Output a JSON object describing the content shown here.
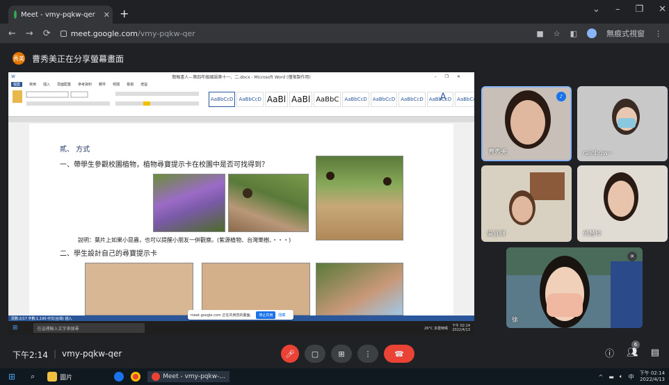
{
  "browser": {
    "tab_title": "Meet - vmy-pqkw-qer",
    "url_host": "meet.google.com",
    "url_path": "/vmy-pqkw-qer",
    "profile_label": "無痕式視窗"
  },
  "banner": {
    "avatar_text": "秀美",
    "text": "曹秀美正在分享螢幕畫面"
  },
  "word": {
    "title": "簡報書人—第四年級國語第十一、二.docx - Microsoft Word (僅限製作用)",
    "tabs": [
      "檔案",
      "常用",
      "插入",
      "頁面配置",
      "參考資料",
      "郵件",
      "校閱",
      "檢視",
      "增益"
    ],
    "styles": [
      "AaBbCcD",
      "AaBbCcD",
      "AaBl",
      "AaBl",
      "AaBbC",
      "AaBbCcD",
      "AaBbCcD",
      "AaBbCcD",
      "AaBbCcD",
      "AaBbCcD"
    ],
    "heading": "貳、 方式",
    "line1": "一、帶學生參觀校園植物，植物尋寶提示卡在校園中是否可找得到？",
    "caption": "說明：葉片上如果小昆蟲，也可以提醒小朋友一併觀察。(紫源植物、台灣樂樹、・・・)",
    "line2": "二、學生設計自己的尋寶提示卡",
    "status": "頁數:2/17  字數:1,190  中文(台灣)  插入",
    "share_popup": {
      "text": "meet.google.com 正在共用您的畫面。",
      "stop": "停止共用",
      "hide": "隱藏"
    },
    "taskbar_search": "在這裡輸入文字來搜尋",
    "taskbar_weather": "26°C 多雲時晴",
    "taskbar_time": "下午 02:14",
    "taskbar_date": "2022/4/13"
  },
  "participants": [
    {
      "name": "曹秀美"
    },
    {
      "name": "rainbow~"
    },
    {
      "name": "吳宜珊"
    },
    {
      "name": "何慧玲"
    },
    {
      "name": "徐"
    }
  ],
  "bottom": {
    "time": "下午2:14",
    "code": "vmy-pqkw-qer",
    "people_count": "6"
  },
  "windows_taskbar": {
    "explorer": "圖片",
    "chrome": "Meet - vmy-pqkw-...",
    "time": "下午 02:14",
    "date": "2022/4/13"
  },
  "colors": {
    "accent": "#1a73e8",
    "danger": "#ea4335",
    "bg": "#202124"
  }
}
